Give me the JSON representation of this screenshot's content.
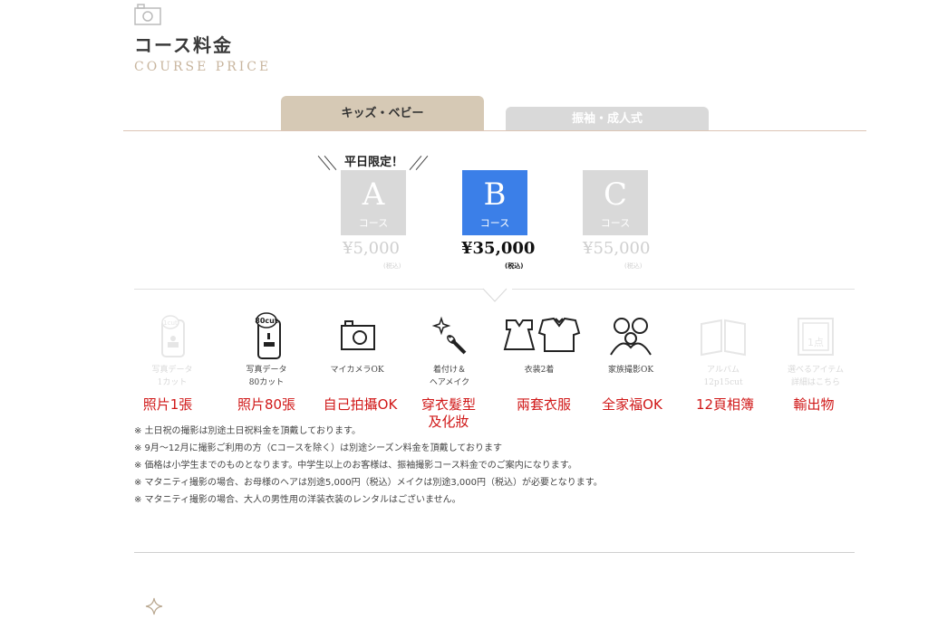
{
  "section": {
    "title": "コース料金",
    "subtitle": "COURSE PRICE",
    "icon": "camera-icon"
  },
  "tabs": [
    {
      "label": "キッズ・ベビー",
      "active": true
    },
    {
      "label": "振袖・成人式",
      "active": false
    }
  ],
  "limited_label": "平日限定！",
  "courses": [
    {
      "letter": "A",
      "word": "コース",
      "price": "¥5,000",
      "tax": "(税込)",
      "selected": false
    },
    {
      "letter": "B",
      "word": "コース",
      "price": "¥35,000",
      "tax": "(税込)",
      "selected": true
    },
    {
      "letter": "C",
      "word": "コース",
      "price": "¥55,000",
      "tax": "(税込)",
      "selected": false
    }
  ],
  "features": [
    {
      "line1": "写真データ",
      "line2": "1カット",
      "badge": "1cut",
      "annotation": "照片1張",
      "enabled": false
    },
    {
      "line1": "写真データ",
      "line2": "80カット",
      "badge": "80cut",
      "annotation": "照片80張",
      "enabled": true
    },
    {
      "line1": "マイカメラOK",
      "line2": "",
      "annotation": "自己拍攝OK",
      "enabled": true
    },
    {
      "line1": "着付け＆",
      "line2": "ヘアメイク",
      "annotation": "穿衣髮型",
      "annotation2": "及化妝",
      "enabled": true
    },
    {
      "line1": "衣装2着",
      "line2": "",
      "annotation": "兩套衣服",
      "enabled": true
    },
    {
      "line1": "家族撮影OK",
      "line2": "",
      "annotation": "全家福OK",
      "enabled": true
    },
    {
      "line1": "アルバム",
      "line2": "12p15cut",
      "annotation": "12頁相簿",
      "enabled": false
    },
    {
      "line1": "選べるアイテム",
      "line2": "詳細はこちら",
      "badge": "1点",
      "annotation": "輸出物",
      "enabled": false
    }
  ],
  "notes": [
    "※ 土日祝の撮影は別途土日祝料金を頂戴しております。",
    "※ 9月～12月に撮影ご利用の方（Cコースを除く）は別途シーズン料金を頂戴しております",
    "※ 価格は小学生までのものとなります。中学生以上のお客様は、振袖撮影コース料金でのご案内になります。",
    "※ マタニティ撮影の場合、お母様のヘアは別途5,000円（税込）メイクは別途3,000円（税込）が必要となります。",
    "※ マタニティ撮影の場合、大人の男性用の洋装衣装のレンタルはございません。"
  ],
  "colors": {
    "accent_blue": "#3b7fe8",
    "tab_active": "#d6c9b5",
    "tab_inactive": "#d9d9d9",
    "subtitle_tan": "#c8b59e",
    "annotation_red": "#d01818"
  }
}
